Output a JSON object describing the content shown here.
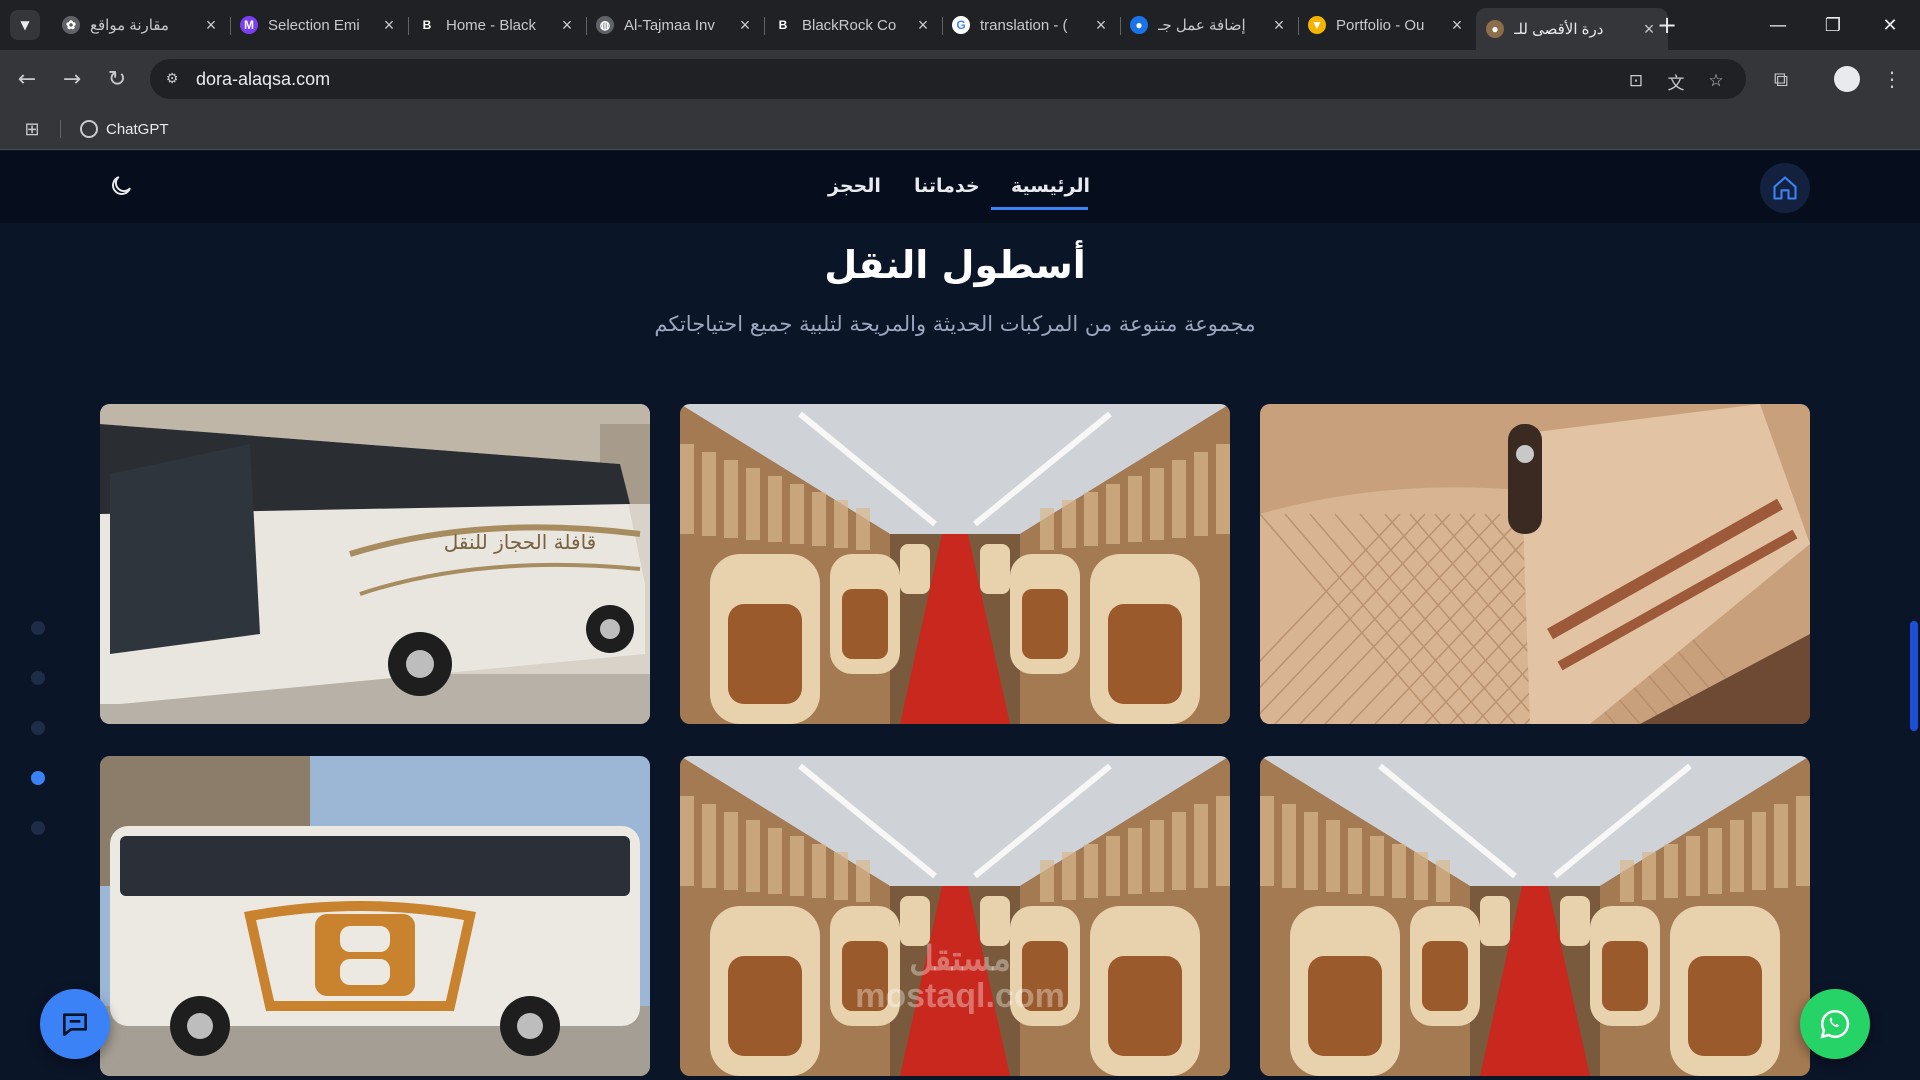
{
  "browser": {
    "tabs": [
      {
        "title": "مقارنة مواقع",
        "favicon_color": "#5f6368",
        "favicon_glyph": "✿",
        "active": false
      },
      {
        "title": "Selection Emi",
        "favicon_color": "#7b3ff2",
        "favicon_glyph": "M",
        "active": false
      },
      {
        "title": "Home - Black",
        "favicon_color": "#202124",
        "favicon_glyph": "B",
        "active": false
      },
      {
        "title": "Al-Tajmaa Inv",
        "favicon_color": "#5f6368",
        "favicon_glyph": "◍",
        "active": false
      },
      {
        "title": "BlackRock Co",
        "favicon_color": "#202124",
        "favicon_glyph": "B",
        "active": false
      },
      {
        "title": "translation - (",
        "favicon_color": "#ffffff",
        "favicon_glyph": "G",
        "active": false
      },
      {
        "title": "إضافة عمل جـ",
        "favicon_color": "#1a73e8",
        "favicon_glyph": "●",
        "active": false
      },
      {
        "title": "Portfolio - Ou",
        "favicon_color": "#f4b400",
        "favicon_glyph": "▼",
        "active": false
      },
      {
        "title": "درة الأقصى للـ",
        "favicon_color": "#8d6e4a",
        "favicon_glyph": "●",
        "active": true
      }
    ],
    "url": "dora-alaqsa.com",
    "bookmark": "ChatGPT"
  },
  "nav": {
    "links": [
      {
        "label": "الرئيسية",
        "active": true
      },
      {
        "label": "خدماتنا",
        "active": false
      },
      {
        "label": "الحجز",
        "active": false
      }
    ]
  },
  "section": {
    "title": "أسطول النقل",
    "subtitle": "مجموعة متنوعة من المركبات الحديثة والمريحة لتلبية جميع احتياجاتكم"
  },
  "gallery": {
    "images": [
      {
        "name": "seat-closeup",
        "kind": "seat",
        "label": ""
      },
      {
        "name": "interior-aisle",
        "kind": "interior",
        "label": ""
      },
      {
        "name": "bus-exterior-1",
        "kind": "bus",
        "label": "قافلة الحجاز للنقل"
      },
      {
        "name": "interior-wide",
        "kind": "interior",
        "label": ""
      },
      {
        "name": "interior-seats",
        "kind": "interior",
        "label": ""
      },
      {
        "name": "bus-exterior-2",
        "kind": "bus2",
        "label": ""
      }
    ]
  },
  "carousel": {
    "count": 5,
    "active_index": 3
  },
  "watermark": {
    "arabic": "مستقل",
    "latin": "mostaql.com"
  },
  "colors": {
    "accent": "#3b82f6",
    "background": "#0b1528",
    "navbar": "#060d1c",
    "whatsapp": "#25d366"
  },
  "icons": {
    "theme": "moon-icon",
    "home": "home-icon",
    "chat": "chat-icon",
    "whatsapp": "whatsapp-icon"
  }
}
